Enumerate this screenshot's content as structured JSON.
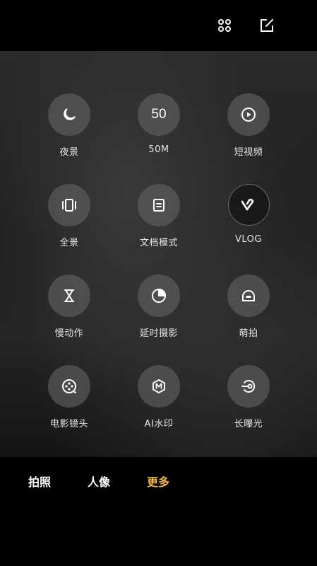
{
  "top": {
    "grid_icon": "grid-dots-icon",
    "edit_icon": "edit-icon"
  },
  "modes": [
    {
      "label": "夜景",
      "icon": "moon-icon"
    },
    {
      "label": "50M",
      "icon": "50"
    },
    {
      "label": "短视频",
      "icon": "play-icon"
    },
    {
      "label": "全景",
      "icon": "panorama-icon"
    },
    {
      "label": "文档模式",
      "icon": "document-icon"
    },
    {
      "label": "VLOG",
      "icon": "vlog-icon"
    },
    {
      "label": "慢动作",
      "icon": "hourglass-icon"
    },
    {
      "label": "延时摄影",
      "icon": "timelapse-icon"
    },
    {
      "label": "萌拍",
      "icon": "cute-icon"
    },
    {
      "label": "电影镜头",
      "icon": "film-reel-icon"
    },
    {
      "label": "AI水印",
      "icon": "ai-watermark-icon"
    },
    {
      "label": "长曝光",
      "icon": "long-exposure-icon"
    }
  ],
  "tabs": [
    {
      "label": "拍照"
    },
    {
      "label": "人像"
    },
    {
      "label": "更多"
    }
  ],
  "colors": {
    "active_tab": "#f0b64a"
  }
}
